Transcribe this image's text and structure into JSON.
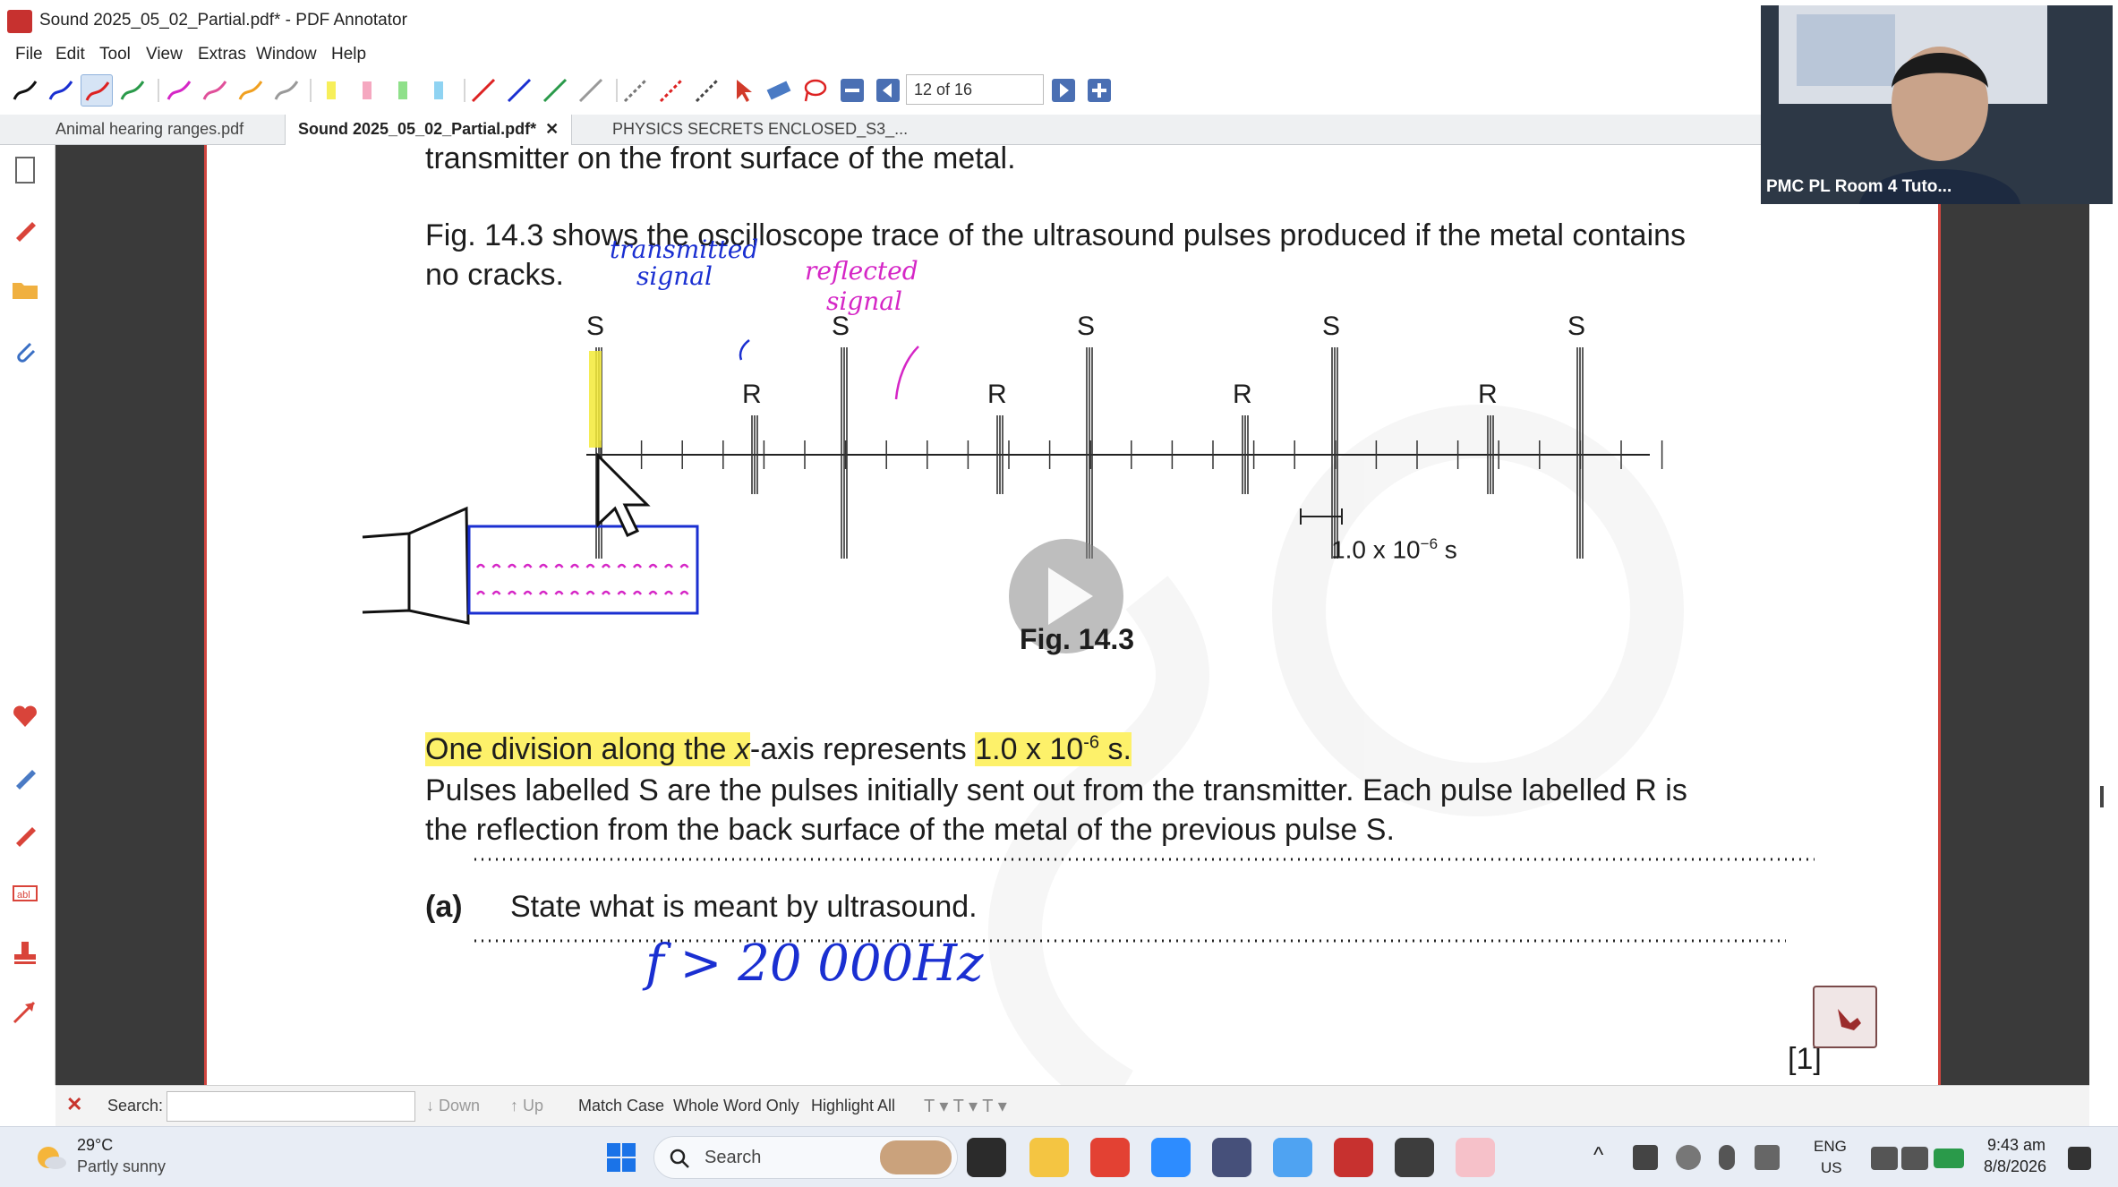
{
  "window": {
    "title": "Sound 2025_05_02_Partial.pdf* - PDF Annotator"
  },
  "menu": [
    "File",
    "Edit",
    "Tool",
    "View",
    "Extras",
    "Window",
    "Help"
  ],
  "toolbar": {
    "page_indicator": "12 of 16"
  },
  "tabs": [
    {
      "label": "Animal hearing ranges.pdf",
      "active": false
    },
    {
      "label": "Sound 2025_05_02_Partial.pdf*",
      "active": true,
      "close": "✕"
    },
    {
      "label": "PHYSICS SECRETS ENCLOSED_S3_...",
      "active": false
    }
  ],
  "document": {
    "line_top": "transmitter on the front surface of the metal.",
    "fig_desc_1": "Fig. 14.3 shows the oscilloscope trace of the ultrasound pulses produced if the metal contains",
    "fig_desc_2": "no cracks.",
    "pulse_s": "S",
    "pulse_r": "R",
    "scale_label": "1.0 x 10",
    "scale_exp": "−6",
    "scale_unit": " s",
    "fig_caption": "Fig. 14.3",
    "division_hl_1": "One division along the ",
    "division_x": "x",
    "division_mid": "-axis represents ",
    "division_hl_2_a": "1.0 x 10",
    "division_hl_2_exp": "-6",
    "division_hl_2_b": " s.",
    "pulses_1": "Pulses labelled S are the pulses initially sent out from the transmitter. Each pulse labelled R is",
    "pulses_2": "the reflection from the back surface of the metal of the previous pulse S.",
    "q_label": "(a)",
    "q_text": "State what is meant by ultrasound.",
    "marks": "[1]"
  },
  "annotations": {
    "transmitted_1": "transmitted",
    "transmitted_2": "signal",
    "reflected_1": "reflected",
    "reflected_2": "signal",
    "answer": "f > 20 000Hz"
  },
  "video": {
    "participant": "PMC PL Room 4 Tuto..."
  },
  "find_bar": {
    "search_label": "Search:",
    "search_value": "",
    "down": "Down",
    "up": "Up",
    "match_case": "Match Case",
    "whole_word": "Whole Word Only",
    "highlight_all": "Highlight All"
  },
  "taskbar": {
    "weather_temp": "29°C",
    "weather_desc": "Partly sunny",
    "search_label": "Search",
    "lang_1": "ENG",
    "lang_2": "US",
    "time": "9:43 am",
    "date": "8/8/2026"
  },
  "colors": {
    "highlight": "#fdf16a",
    "pen_blue": "#1a2fd1",
    "pen_magenta": "#d526c6",
    "page_border": "#d0453f"
  }
}
